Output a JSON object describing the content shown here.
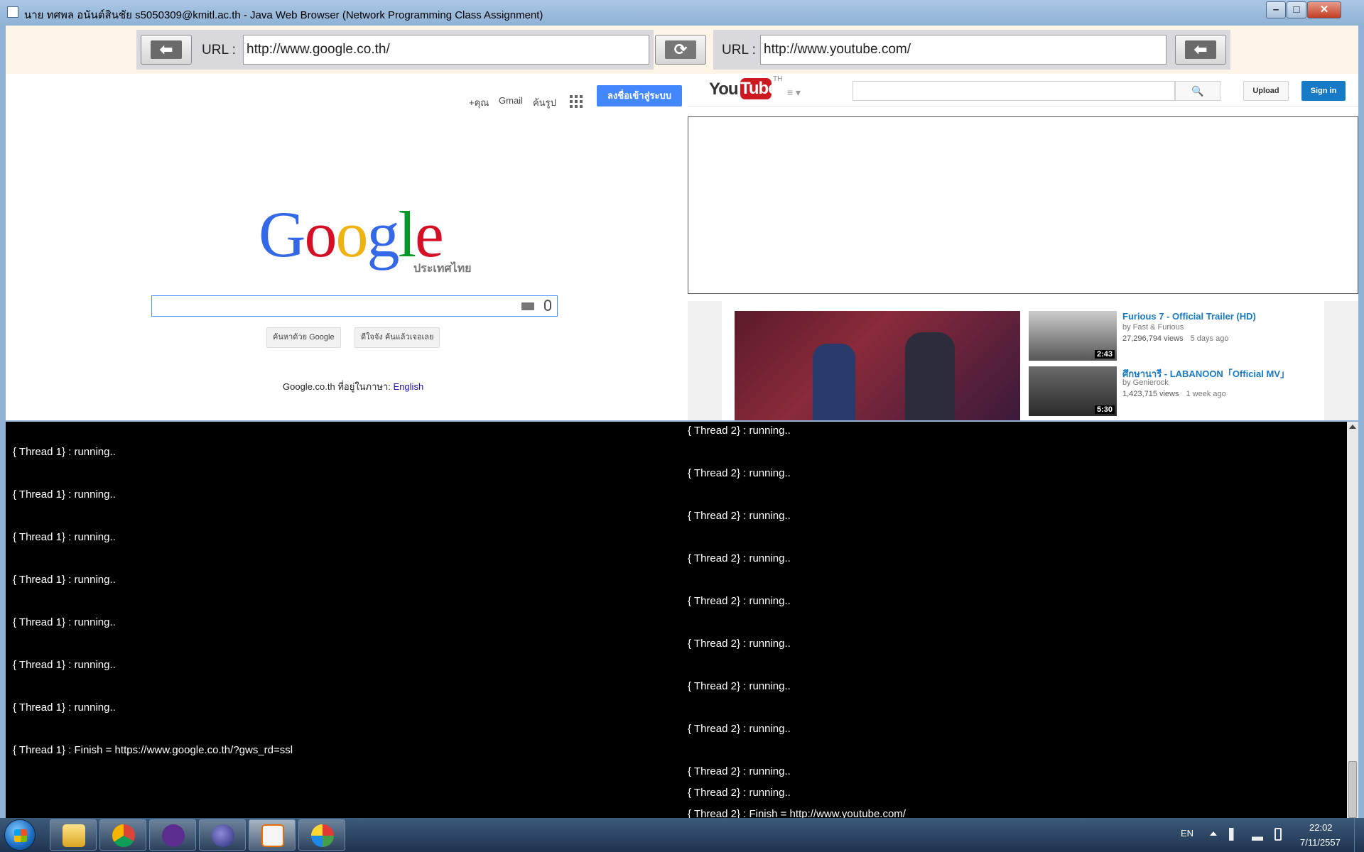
{
  "window": {
    "title": "นาย ทศพล อนันต์สินชัย s5050309@kmitl.ac.th - Java Web Browser (Network Programming Class Assignment)",
    "min_glyph": "–",
    "max_glyph": "□",
    "close_glyph": "✕"
  },
  "toolbar": {
    "back_glyph": "⬅",
    "refresh_glyph": "⟳",
    "url_label_left": "URL :",
    "url_left": "http://www.google.co.th/",
    "url_label_right": "URL :",
    "url_right": "http://www.youtube.com/"
  },
  "google": {
    "top_links": [
      "+คุณ",
      "Gmail",
      "ค้นรูป"
    ],
    "signin": "ลงชื่อเข้าสู่ระบบ",
    "logo_letters": [
      {
        "ch": "G",
        "color": "#3369e8"
      },
      {
        "ch": "o",
        "color": "#d50f25"
      },
      {
        "ch": "o",
        "color": "#eeb211"
      },
      {
        "ch": "g",
        "color": "#3369e8"
      },
      {
        "ch": "l",
        "color": "#009925"
      },
      {
        "ch": "e",
        "color": "#d50f25"
      }
    ],
    "logo_sub": "ประเทศไทย",
    "search_button": "ค้นหาด้วย Google",
    "lucky_button": "ดีใจจัง ค้นแล้วเจอเลย",
    "lang_text": "Google.co.th ที่อยู่ในภาษา:",
    "lang_link": "English"
  },
  "youtube": {
    "logo_you": "You",
    "logo_tube": "Tube",
    "region": "TH",
    "menu_glyph": "≡ ▾",
    "search_glyph": "🔍",
    "upload": "Upload",
    "signin": "Sign in",
    "items": [
      {
        "title": "Furious 7 - Official Trailer (HD)",
        "by": "by Fast & Furious",
        "views": "27,296,794 views",
        "age": "5 days ago",
        "duration": "2:43"
      },
      {
        "title": "ศึกษานารี - LABANOON「Official MV」",
        "by": "by Genierock",
        "views": "1,423,715 views",
        "age": "1 week ago",
        "duration": "5:30"
      }
    ]
  },
  "log": {
    "thread1": [
      "{ Thread 1} : running..",
      "{ Thread 1} : running..",
      "{ Thread 1} : running..",
      "{ Thread 1} : running..",
      "{ Thread 1} : running..",
      "{ Thread 1} : running..",
      "{ Thread 1} : running..",
      "{ Thread 1} : Finish = https://www.google.co.th/?gws_rd=ssl"
    ],
    "thread2": [
      "{ Thread 2} : running..",
      "{ Thread 2} : running..",
      "{ Thread 2} : running..",
      "{ Thread 2} : running..",
      "{ Thread 2} : running..",
      "{ Thread 2} : running..",
      "{ Thread 2} : running..",
      "{ Thread 2} : running..",
      "{ Thread 2} : running..",
      "{ Thread 2} : running..",
      "{ Thread 2} : Finish = http://www.youtube.com/"
    ]
  },
  "taskbar": {
    "items": [
      "explorer-icon",
      "chrome-icon",
      "github-icon",
      "eclipse-icon",
      "java-icon",
      "paint-icon"
    ],
    "lang": "EN",
    "time": "22:02",
    "date": "7/11/2557"
  },
  "colors": {
    "google_blue": "#4387fd",
    "youtube_red": "#cc181e",
    "youtube_blue": "#167ac6",
    "log_bg": "#000000"
  }
}
